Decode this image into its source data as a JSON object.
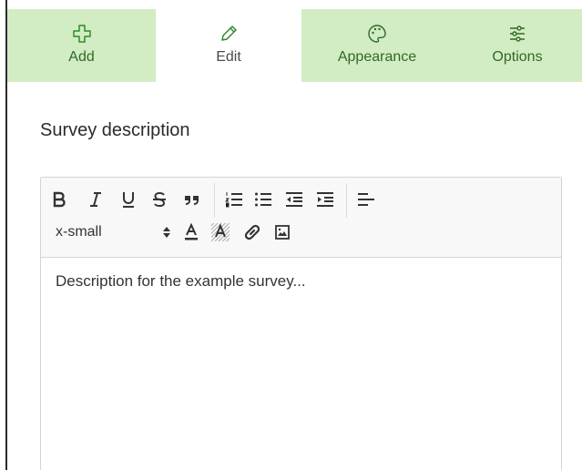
{
  "tabs": [
    {
      "label": "Add",
      "icon": "plus-icon"
    },
    {
      "label": "Edit",
      "icon": "pencil-icon"
    },
    {
      "label": "Appearance",
      "icon": "palette-icon"
    },
    {
      "label": "Options",
      "icon": "sliders-icon"
    }
  ],
  "active_tab": "Edit",
  "section": {
    "title": "Survey description"
  },
  "editor": {
    "font_size": "x-small",
    "content": "Description for the example survey..."
  },
  "colors": {
    "tab_bar_bg": "#d2ecc4",
    "tab_label_green": "#2f6b25",
    "toolbar_bg": "#f8f8f8"
  }
}
